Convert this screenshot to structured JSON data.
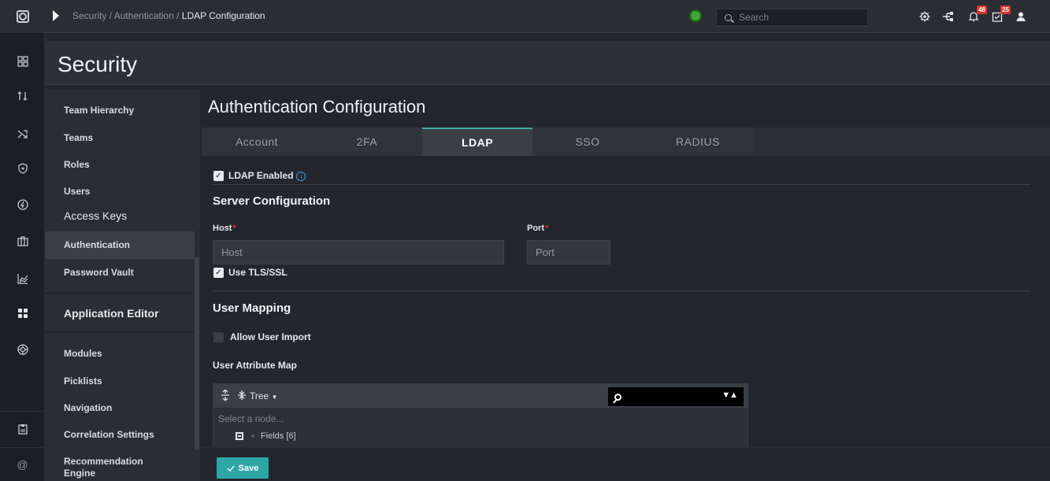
{
  "header": {
    "breadcrumb": "Security / Authentication /",
    "breadcrumb_current": "LDAP Configuration",
    "search_placeholder": "Search",
    "notifications_badge": "48",
    "tasks_badge": "25"
  },
  "page_title": "Security",
  "sidebar": {
    "items": [
      {
        "label": "Team Hierarchy"
      },
      {
        "label": "Teams"
      },
      {
        "label": "Roles"
      },
      {
        "label": "Users"
      },
      {
        "label": "Access Keys"
      },
      {
        "label": "Authentication"
      },
      {
        "label": "Password Vault"
      },
      {
        "label": "Application Editor"
      },
      {
        "label": "Modules"
      },
      {
        "label": "Picklists"
      },
      {
        "label": "Navigation"
      },
      {
        "label": "Correlation Settings"
      },
      {
        "label": "Recommendation Engine"
      }
    ]
  },
  "main": {
    "title": "Authentication Configuration",
    "tabs": [
      "Account",
      "2FA",
      "LDAP",
      "SSO",
      "RADIUS"
    ],
    "active_tab": "LDAP",
    "ldap_enabled_label": "LDAP Enabled",
    "server_config_title": "Server Configuration",
    "host_label": "Host",
    "host_placeholder": "Host",
    "port_label": "Port",
    "port_placeholder": "Port",
    "tls_label": "Use TLS/SSL",
    "user_mapping_title": "User Mapping",
    "allow_import_label": "Allow User Import",
    "attr_map_label": "User Attribute Map",
    "tree": {
      "mode": "Tree",
      "select_placeholder": "Select a node...",
      "node_label": "Fields",
      "node_count": "[6]"
    }
  },
  "footer": {
    "save_label": "Save"
  },
  "colors": {
    "accent": "#2ea6a6",
    "badge": "#d9352c",
    "status": "#3ea832"
  }
}
